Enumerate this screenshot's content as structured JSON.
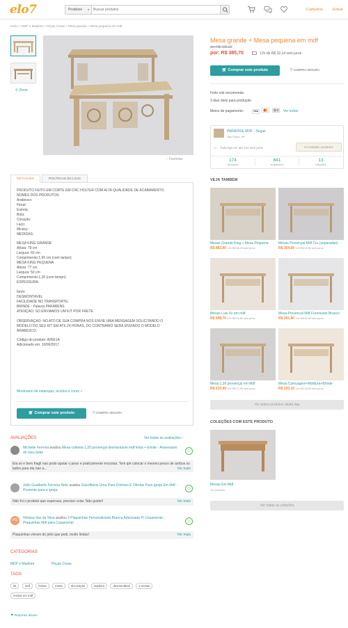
{
  "header": {
    "logo": "elo7",
    "search_category": "Produtos",
    "search_placeholder": "Buscar produtos",
    "register": "Cadastrar",
    "login": "Entrar"
  },
  "breadcrumb": "Início > MDF e Madeira > Peças Cruas > Mesa grande + Mesa pequena em mdf",
  "gallery": {
    "zoom": "Zoom",
    "favorite": "Favoritar"
  },
  "product": {
    "title": "Mesa grande + Mesa pequena em mdf",
    "old_price": "de: R$ 425,10",
    "price": "por: R$ 385,70",
    "installments": "12x de R$ 32,14 sem juros",
    "buy": "Comprar este produto",
    "secure": "COMPRA SEGURA",
    "made_to_order": "Feito sob encomenda",
    "production_days": "3 dias úteis para produção",
    "payment_label": "Meios de pagamento:",
    "payment_cards": [
      "VISA",
      "MasterCard",
      "Boleto"
    ],
    "see_all_payment": "Ver todos"
  },
  "store": {
    "name": "PARADISE MDF - Seguir",
    "location": "São Paulo, SP",
    "installments": "Toda loja em até 12x sem juros",
    "contact": "Contatar vendedor",
    "stats": [
      {
        "value": "174",
        "label": "produtos"
      },
      {
        "value": "641",
        "label": "avaliações"
      },
      {
        "value": "13",
        "label": "coleções"
      }
    ]
  },
  "tabs": {
    "details": "DETALHES",
    "policy": "POLÍTICAS DA LOJA"
  },
  "description": [
    "PRODUTO FEITO EM CORTE EM CNC HOLTER COM ALTA QUALIDADE DE ACABAMENTO.",
    "NOMES DOS PRODUTOS:",
    "Arabesco:",
    "Floral:",
    "Estrela:",
    "Bola:",
    "Coração:",
    "Laço:",
    "Mickey:",
    "MEDIDAS:",
    "",
    "MESA KING GRANDE",
    "Altura: 79 cm",
    "Largura: 60 cm",
    "Comprimento:1,50 cm (com tampo)",
    "MESA KING PEQUENA",
    "Altura: 77 cm",
    "Largura: 50 cm",
    "Comprimento:1,20 (com tampo)",
    "ESPESSURA:",
    "",
    "6mm:",
    "DESMONTÁVEL",
    "FACILIDADE NO TRANSPORTE:",
    "BRINDE - Palavra PARABÉNS",
    "ATENÇÃO: SÓ ENVIAMOS UM KIT POR FRETE",
    "",
    "OBSERVAÇÃO: NO ATO DE SUA COMPRA NOS ENVIE UMA MENSAGEM SOLICITANDO O",
    "MODELO DO SEU KIT EM ATÉ 24 HORAS, DO CONTRÁRIO SERÁ ENVIADO O MODELO",
    "ARABESCO.",
    "",
    "Código do produto: A95E1A",
    "Adicionado em: 10/06/2017"
  ],
  "mostruario": "Mostruário de estampas, tecidos e cores »",
  "reviews": {
    "title": "AVALIAÇÕES",
    "see_all": "Ver todas as avaliações ›",
    "more": "Ver mais",
    "items": [
      {
        "user": "Michelle Ferreira",
        "verb": "avaliou",
        "product": "Mesa colmeia 1,20 provençal desmontavel mdf festa + brinde - Aniversário do meu bebe",
        "text": "Ela so e bem fragil nao pode apoiar o peso e praticamente encostar. Tem q/e colocar o mesmo pesos de ambos os lados para ela nao a..."
      },
      {
        "user": "João Gualberto Ferreira Neto",
        "verb": "avaliou",
        "product": "Gazofilácio Uma Para Dízimos E Ofertas Para Igreja Em Mdf - Presente para a igreja.",
        "text": "Não foi o produto que esperava, precisei colar. Não gostei!"
      },
      {
        "initials": "HS",
        "user": "Heloisa Vaz da Silva",
        "verb": "avaliou",
        "product": "3 Plaquinhas Personalizada Branca Adesivada P/ Casamento - Plaquinhas Mdf para Casamento",
        "text": "Plaquinhas vieram do jeito que pedi, muito lindas!"
      }
    ]
  },
  "categories": {
    "title": "CATEGORIAS",
    "items": [
      "MDF e Madeira",
      "Peças Cruas"
    ]
  },
  "tags": {
    "title": "TAGS",
    "items": [
      "kit",
      "mdf",
      "festas",
      "mesa",
      "decoração",
      "madeira",
      "desmontável",
      "2 mesas",
      "mesas em mdf"
    ]
  },
  "report": "Reportar abuso",
  "see_also": {
    "title": "VEJA TAMBÉM",
    "products": [
      {
        "name": "Mesas Grande King + Mesa Pequena",
        "price": "R$ 683,90",
        "inst": "12x R$ 56,99 sem juros",
        "color": "#d7d1c8"
      },
      {
        "name": "Mesas Provençal Mdf Cru (separadas)",
        "price": "R$ 354,00",
        "inst": "12x R$ 29,50 sem juros",
        "color": "#cfcccf"
      },
      {
        "name": "Mesas Luis Xv em mdf",
        "price": "R$ 298,70",
        "inst": "12x R$ 24,89 sem juros",
        "color": "#e9e3dc"
      },
      {
        "name": "Mesa Provencal Mdf Formicado Branco",
        "price": "R$ 391,80",
        "inst": "12x R$ 32,65 sem juros",
        "color": "#e6e6e8"
      },
      {
        "name": "Mesa 1,30 provençal em Mdf",
        "price": "R$ 215,90",
        "inst": "12x R$ 17,99 sem juros",
        "color": "#d4d2d0"
      },
      {
        "name": "Mesa Camuagem+Moldura+Brinde",
        "price": "R$ 193,10",
        "inst": "12x R$ 16,09 sem juros",
        "color": "#efe6dc"
      }
    ],
    "see_store": "Ver todos produtos desta loja"
  },
  "collections": {
    "title": "COLEÇÕES COM ESTE PRODUTO",
    "name": "Mesas Em Mdf",
    "count": "12 produtos",
    "see_all": "Ver todas as coleções"
  }
}
